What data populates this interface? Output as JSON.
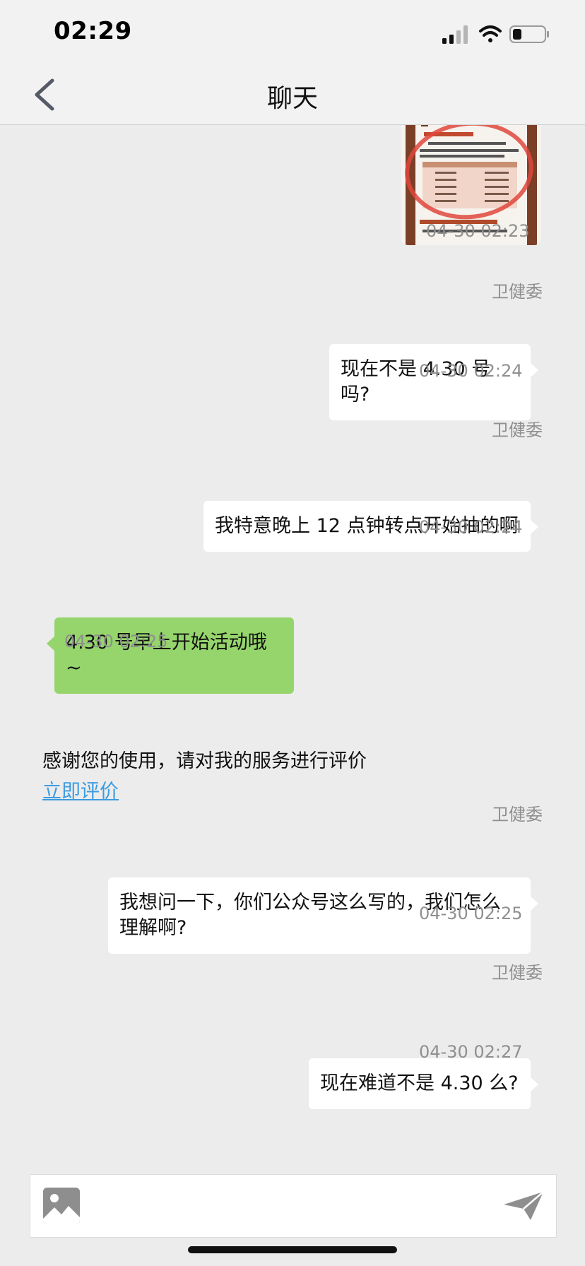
{
  "status_bar": {
    "time": "02:29"
  },
  "nav": {
    "title": "聊天"
  },
  "messages": [
    {
      "type": "image",
      "timestamp": "04-30 02:23"
    },
    {
      "type": "text",
      "side": "right",
      "sender": "卫健委",
      "text": "现在不是 4.30 号吗?",
      "timestamp": "04-30 02:24"
    },
    {
      "type": "text",
      "side": "right",
      "sender": "卫健委",
      "text": "我特意晚上 12 点钟转点开始抽的啊",
      "timestamp": "04-30 02:24"
    },
    {
      "type": "text",
      "side": "left",
      "text": "4.30 号早上开始活动哦 ~",
      "timestamp": "04-30 02:25"
    },
    {
      "type": "system",
      "text": "感谢您的使用，请对我的服务进行评价",
      "link": "立即评价"
    },
    {
      "type": "text",
      "side": "right",
      "sender": "卫健委",
      "text": "我想问一下，你们公众号这么写的，我们怎么理解啊?",
      "timestamp": "04-30 02:25"
    },
    {
      "type": "text",
      "side": "right",
      "sender": "卫健委",
      "text": "现在难道不是 4.30 么?",
      "timestamp": "04-30 02:27"
    }
  ],
  "colors": {
    "accent_green": "#95d56c",
    "link_blue": "#3c9be0",
    "background": "#ececec"
  },
  "icons": {
    "back": "chevron-left-icon",
    "image": "image-icon",
    "send": "paper-plane-icon"
  }
}
